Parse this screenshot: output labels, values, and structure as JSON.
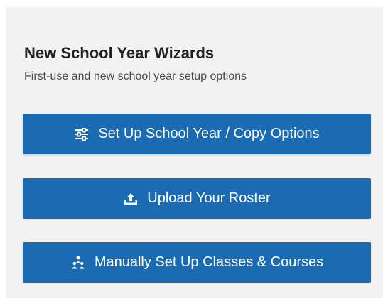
{
  "panel": {
    "title": "New School Year Wizards",
    "subtitle": "First-use and new school year setup options",
    "buttons": [
      {
        "label": "Set Up School Year / Copy Options",
        "icon": "sliders-icon"
      },
      {
        "label": "Upload Your Roster",
        "icon": "upload-icon"
      },
      {
        "label": "Manually Set Up Classes & Courses",
        "icon": "people-group-icon"
      }
    ]
  },
  "colors": {
    "panel_background": "#f2f2f2",
    "button_background": "#1b6bb3",
    "button_text": "#ffffff",
    "title_text": "#1f1f1f",
    "subtitle_text": "#4a4a4a"
  }
}
